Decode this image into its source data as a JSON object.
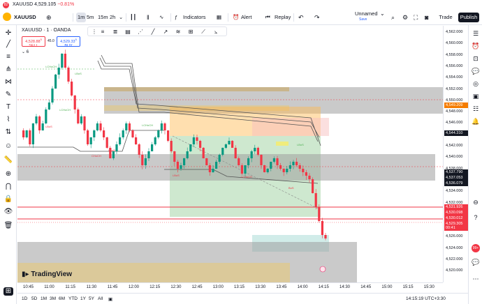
{
  "tab": {
    "symbol": "XAUUSD",
    "price": "4,529.105",
    "change": "−0.81%",
    "badge": "82"
  },
  "toolbar": {
    "symbol": "XAUUSD",
    "intervals": [
      "1m",
      "5m",
      "15m",
      "2h"
    ],
    "active_interval": "1m",
    "indicators_label": "Indicators",
    "alert_label": "Alert",
    "replay_label": "Replay",
    "layout_name": "Unnamed",
    "layout_status": "Save",
    "trade_label": "Trade",
    "publish_label": "Publish"
  },
  "legend": {
    "title": "XAUUSD · 1 · OANDA",
    "sell_price": "4,528.88",
    "sell_sup": "5",
    "sell_label": "SELL",
    "buy_price": "4,529.33",
    "buy_sup": "5",
    "buy_label": "BUY",
    "spread": "45.0",
    "indicator_count": "6"
  },
  "chart_annotations": [
    "i-CHoCH",
    "i-BoS",
    "i-BoS",
    "i-CHoCH",
    "CHoCH",
    "i-CHoCH",
    "i-BoS",
    "i-BoS",
    "i-CHoCH",
    "i-BoS",
    "BoS"
  ],
  "price_axis": {
    "ticks": [
      "4,562.000",
      "4,560.000",
      "4,558.000",
      "4,556.000",
      "4,554.000",
      "4,552.000",
      "4,550.000",
      "4,548.000",
      "4,546.000",
      "4,544.000",
      "4,542.000",
      "4,540.000",
      "4,538.000",
      "4,536.000",
      "4,534.000",
      "4,532.000",
      "4,530.000",
      "4,528.000",
      "4,526.000",
      "4,524.000",
      "4,522.000",
      "4,520.000"
    ],
    "tags": [
      {
        "text": "4,549.209",
        "color": "#f57c00"
      },
      {
        "text": "4,544.310",
        "color": "#131722"
      },
      {
        "text": "4,537.790",
        "color": "#131722"
      },
      {
        "text": "4,537.053",
        "color": "#131722"
      },
      {
        "text": "4,536.079",
        "color": "#131722"
      },
      {
        "text": "4,531.926",
        "color": "#f23645"
      },
      {
        "text": "4,530.098",
        "color": "#f23645"
      },
      {
        "text": "4,530.012",
        "color": "#f23645"
      },
      {
        "text": "4,529.305",
        "color": "#f23645"
      },
      {
        "text": "00:41",
        "color": "#f23645"
      }
    ]
  },
  "time_axis": [
    "10:45",
    "11:00",
    "11:15",
    "11:30",
    "11:45",
    "12:00",
    "12:15",
    "12:30",
    "12:45",
    "13:00",
    "13:15",
    "13:30",
    "13:45",
    "14:00",
    "14:15",
    "14:30",
    "14:45",
    "15:00",
    "15:15",
    "15:30"
  ],
  "bottom": {
    "ranges": [
      "1D",
      "5D",
      "1M",
      "3M",
      "6M",
      "YTD",
      "1Y",
      "5Y",
      "All"
    ],
    "clock": "14:15:19 UTC+3:30"
  },
  "logo_text": "TradingView",
  "colors": {
    "up": "#089981",
    "down": "#f23645",
    "accent": "#2962ff"
  }
}
